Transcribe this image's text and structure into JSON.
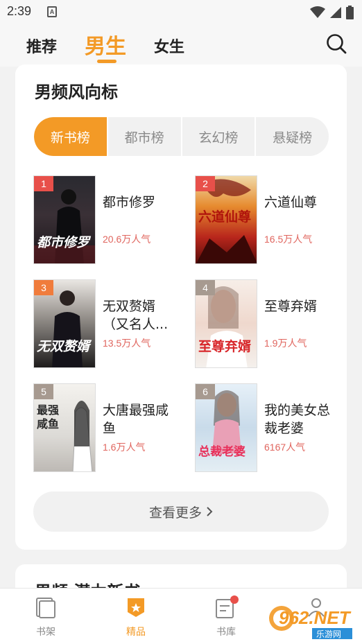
{
  "status_bar": {
    "time": "2:39",
    "notif_glyph": "A"
  },
  "top_tabs": [
    "推荐",
    "男生",
    "女生"
  ],
  "active_tab": 1,
  "section": {
    "title": "男频风向标",
    "segments": [
      "新书榜",
      "都市榜",
      "玄幻榜",
      "悬疑榜"
    ],
    "active_segment": 0,
    "books": [
      {
        "rank": "1",
        "name": "都市修罗",
        "popularity": "20.6万人气",
        "cover_text": "都市修罗"
      },
      {
        "rank": "2",
        "name": "六道仙尊",
        "popularity": "16.5万人气",
        "cover_text": "六道仙尊"
      },
      {
        "rank": "3",
        "name": "无双赘婿（又名人...",
        "popularity": "13.5万人气",
        "cover_text": "无双赘婿"
      },
      {
        "rank": "4",
        "name": "至尊弃婿",
        "popularity": "1.9万人气",
        "cover_text": "至尊弃婿"
      },
      {
        "rank": "5",
        "name": "大唐最强咸鱼",
        "popularity": "1.6万人气",
        "cover_text": "最强咸鱼"
      },
      {
        "rank": "6",
        "name": "我的美女总裁老婆",
        "popularity": "6167人气",
        "cover_text": "总裁老婆"
      }
    ],
    "more_label": "查看更多"
  },
  "next_section": {
    "title": "男频 潜力新书"
  },
  "bottom_nav": [
    {
      "label": "书架",
      "icon": "bookshelf-icon"
    },
    {
      "label": "精品",
      "icon": "premium-badge-icon"
    },
    {
      "label": "书库",
      "icon": "library-icon"
    },
    {
      "label": "",
      "icon": "profile-icon"
    }
  ],
  "watermark": {
    "text": "962.NET",
    "sub": "乐游网"
  },
  "colors": {
    "accent": "#f39a26",
    "popularity": "#e0655e",
    "rank_top": "#e8504a",
    "rank_mid": "#f07c3c",
    "rank_low": "#a79a90"
  }
}
